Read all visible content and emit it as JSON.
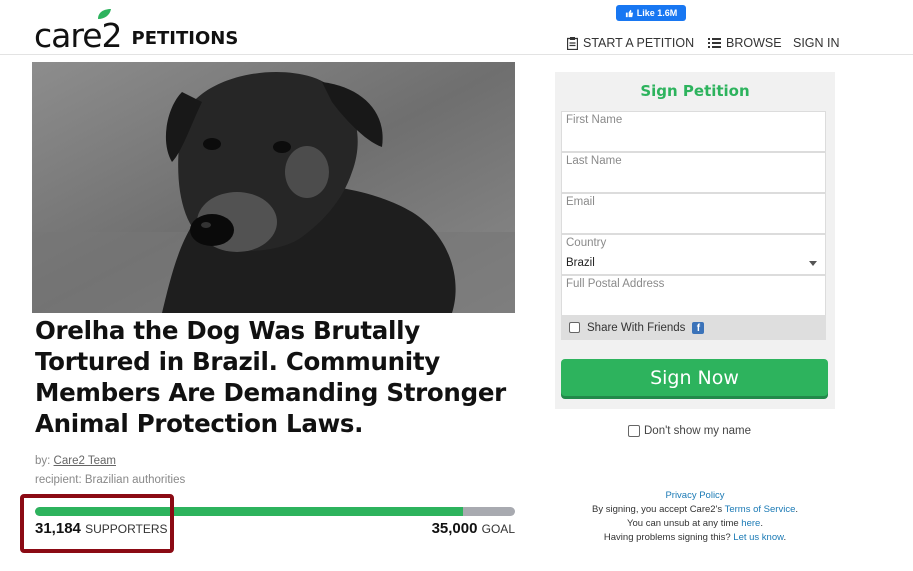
{
  "header": {
    "logo_word": "care2",
    "logo_suffix": "PETITIONS",
    "fb_like": "Like 1.6M",
    "nav": {
      "start": "START A PETITION",
      "browse": "BROWSE",
      "signin": "SIGN IN"
    }
  },
  "petition": {
    "title": "Orelha the Dog Was Brutally Tortured in Brazil. Community Members Are Demanding Stronger Animal Protection Laws.",
    "by_label": "by:",
    "author": "Care2 Team",
    "recipient": "recipient: Brazilian authorities",
    "supporters": "31,184",
    "supporters_label": "SUPPORTERS",
    "goal": "35,000",
    "goal_label": "GOAL",
    "progress_fraction": 0.891
  },
  "sign_form": {
    "title": "Sign Petition",
    "first_name_placeholder": "First Name",
    "last_name_placeholder": "Last Name",
    "email_placeholder": "Email",
    "country_label": "Country",
    "country_value": "Brazil",
    "address_placeholder": "Full Postal Address",
    "share_label": "Share With Friends",
    "share_icon": "facebook-icon",
    "submit_label": "Sign Now",
    "hide_name_label": "Don't show my name"
  },
  "legal": {
    "privacy_link": "Privacy Policy",
    "accept_prefix": "By signing, you accept Care2's ",
    "tos_link": "Terms of Service",
    "accept_suffix": ".",
    "unsub_prefix": "You can unsub at any time ",
    "unsub_link": "here",
    "unsub_suffix": ".",
    "help_prefix": "Having problems signing this? ",
    "help_link": "Let us know",
    "help_suffix": "."
  },
  "colors": {
    "brand_green": "#2db35d",
    "highlight_red": "#8b0a14",
    "link_blue": "#1b7ab5",
    "facebook_blue": "#1877f2"
  }
}
